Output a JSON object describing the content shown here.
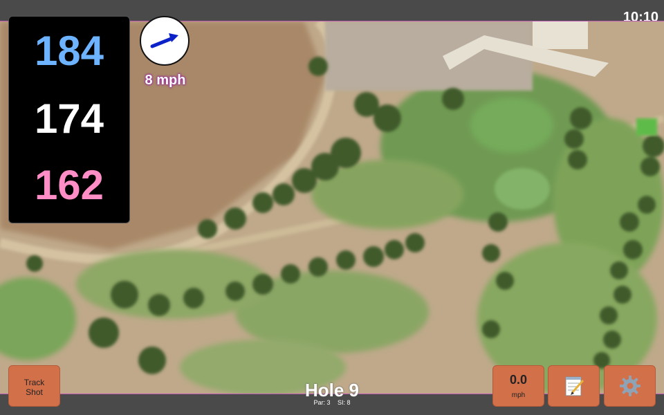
{
  "status": {
    "time": "10:10"
  },
  "distances": {
    "back": "184",
    "middle": "174",
    "front": "162"
  },
  "wind": {
    "speed": "8 mph",
    "icon": "wind-direction-arrow-icon",
    "arrow_color": "#0b22c9"
  },
  "hole": {
    "title": "Hole 9",
    "par": "Par: 3",
    "si": "SI: 8"
  },
  "buttons": {
    "track_shot": [
      "Track",
      "Shot"
    ],
    "speed_value": "0.0",
    "speed_unit": "mph",
    "notes_icon": "notepad-icon",
    "settings_icon": "gear-icon"
  },
  "colors": {
    "button": "#d2704a",
    "back_distance": "#6db3ff",
    "front_distance": "#ff8ec6",
    "accent": "#c05bb5"
  }
}
